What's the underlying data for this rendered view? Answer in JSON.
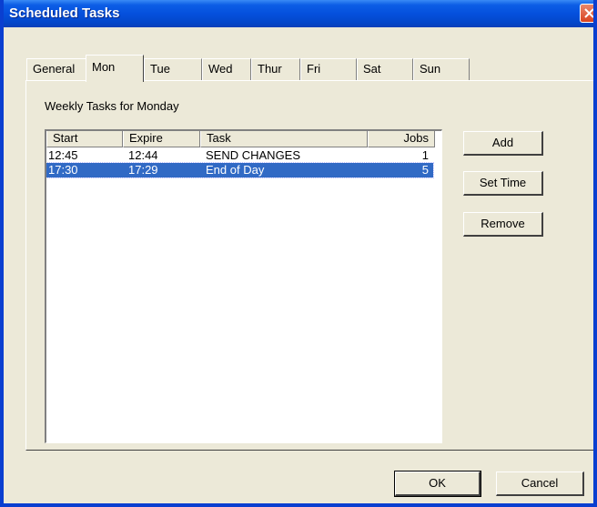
{
  "window": {
    "title": "Scheduled Tasks"
  },
  "tabs": [
    "General",
    "Mon",
    "Tue",
    "Wed",
    "Thur",
    "Fri",
    "Sat",
    "Sun"
  ],
  "active_tab": "Mon",
  "section_label": "Weekly Tasks for Monday",
  "list": {
    "columns": [
      "Start",
      "Expire",
      "Task",
      "Jobs"
    ],
    "rows": [
      {
        "start": "12:45",
        "expire": "12:44",
        "task": "SEND CHANGES",
        "jobs": "1",
        "selected": false
      },
      {
        "start": "17:30",
        "expire": "17:29",
        "task": "End of Day",
        "jobs": "5",
        "selected": true
      }
    ]
  },
  "side_buttons": {
    "add": "Add",
    "set_time": "Set Time",
    "remove": "Remove"
  },
  "footer_buttons": {
    "ok": "OK",
    "cancel": "Cancel"
  },
  "colors": {
    "title_bar": "#0550dd",
    "selection": "#316ac5",
    "face": "#ece9d8",
    "close": "#d9431f"
  }
}
